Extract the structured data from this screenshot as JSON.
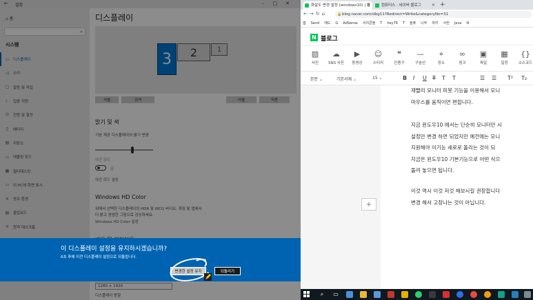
{
  "settings": {
    "window_title": "설정",
    "home_label": "홈",
    "section_label": "시스템",
    "nav_items": [
      {
        "label": "디스플레이",
        "icon": "monitor-icon"
      },
      {
        "label": "소리",
        "icon": "speaker-icon"
      },
      {
        "label": "알림 및 작업",
        "icon": "notification-icon"
      },
      {
        "label": "집중 지원",
        "icon": "moon-icon"
      },
      {
        "label": "전원 및 절전",
        "icon": "power-icon"
      },
      {
        "label": "배터리",
        "icon": "battery-icon"
      },
      {
        "label": "저장소",
        "icon": "storage-icon"
      },
      {
        "label": "태블릿 모드",
        "icon": "tablet-icon"
      },
      {
        "label": "멀티태스킹",
        "icon": "multitask-icon"
      },
      {
        "label": "이 PC에 화면 표시",
        "icon": "project-icon"
      },
      {
        "label": "공유 환경",
        "icon": "share-icon"
      },
      {
        "label": "클립보드",
        "icon": "clipboard-icon"
      },
      {
        "label": "원격 데스크톱",
        "icon": "remote-icon"
      },
      {
        "label": "정보",
        "icon": "info-icon"
      }
    ],
    "page_title": "디스플레이",
    "monitors": [
      "3",
      "2",
      "1"
    ],
    "preview_buttons": [
      "식별",
      "검색",
      "식별",
      "적용"
    ],
    "brightness_heading": "밝기 및 색",
    "brightness_label": "기본 제공 디스플레이의 밝기 변경",
    "night_light_label": "야간 모드",
    "night_light_state": "끔",
    "night_light_settings": "야간 모드 설정",
    "hdr_heading": "Windows HD Color",
    "hdr_desc_1": "위에서 선택한 디스플레이의 HDR 및 WCG 비디오, 게임 및 앱에서",
    "hdr_desc_2": "더 밝고 생생한 그림으로 감상하세요.",
    "hdr_link": "Windows HD Color 설정",
    "layout_heading": "배율 및 레이아웃",
    "resolution_value": "1280 × 1920",
    "orientation_label": "디스플레이 방향"
  },
  "banner": {
    "question": "이 디스플레이 설정을 유지하시겠습니까?",
    "countdown": "6초 후에 이전 디스플레이 설정으로 되돌립니다.",
    "keep_label": "변경한 설정 유지",
    "revert_label": "되돌리기"
  },
  "chrome": {
    "tabs": [
      {
        "title": "화살도 변경 설정 (windows10) | 블"
      },
      {
        "title": "컴퓨터스 : 네이버 블로그"
      }
    ],
    "url": "blog.naver.com/dbg11?Redirect=Write&categoryNo=31",
    "bookmarks": [
      "앱",
      "Send",
      "애드",
      "G",
      "AdSense",
      "서치콘솔",
      "T",
      "hey76",
      "T",
      "컴퓨",
      "나무",
      "위키",
      "사전",
      "Java",
      "N"
    ],
    "blog_title": "블로그",
    "tools": [
      {
        "label": "사진",
        "icon": "photo-icon"
      },
      {
        "label": "SNS 사진",
        "icon": "cloud-upload-icon"
      },
      {
        "label": "동영상",
        "icon": "video-icon"
      },
      {
        "label": "스티커",
        "icon": "sticker-icon"
      },
      {
        "label": "인용구",
        "icon": "quote-icon"
      },
      {
        "label": "구분선",
        "icon": "divider-icon"
      },
      {
        "label": "장소",
        "icon": "place-icon"
      },
      {
        "label": "링크",
        "icon": "link-icon"
      },
      {
        "label": "파일",
        "icon": "file-icon"
      },
      {
        "label": "일정",
        "icon": "calendar-icon"
      },
      {
        "label": "소스코드",
        "icon": "code-icon"
      }
    ],
    "format": {
      "style": "본문",
      "font": "기본서체",
      "size": "15"
    },
    "paragraphs": [
      [
        "재빨리 모니터 피봇 기능을 이용해서 모니",
        "마우스를 움직이면 편합니다."
      ],
      [
        "지금 윈도우10 에서는 단순히 모니터만 시",
        "설정만 변경 하면 되었지만 예전에는 모니",
        "지원해야 이기능 세로로 돌리는 것이 되",
        "지금은 윈도우10 기본기능으로 어떤 식으",
        "돌려 놓으면 됩니다."
      ],
      [
        "이것 역시 이것 저것 해보시길 권장합니다",
        "변경 해서 고장나는 것이 아닙니다."
      ]
    ]
  },
  "colors": {
    "accent_blue": "#0063b1",
    "naver_green": "#03c75a",
    "monitor_selected": "#0078d7"
  }
}
